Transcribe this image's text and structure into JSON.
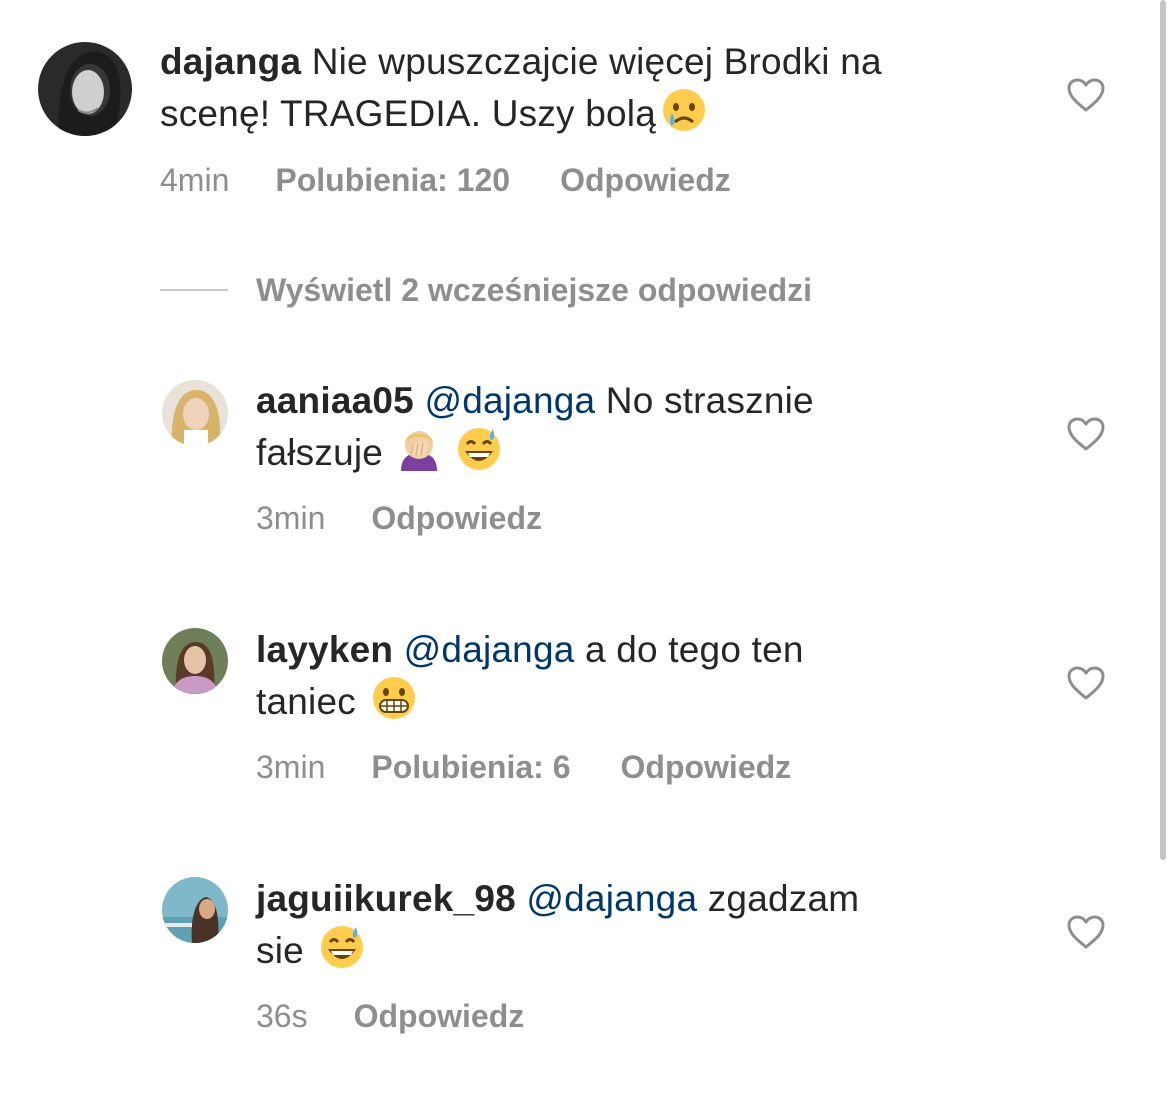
{
  "comments": [
    {
      "username": "dajanga",
      "text_line1": "Nie wpuszczajcie więcej Brodki na",
      "text_line2": "scenę! TRAGEDIA. Uszy bolą",
      "emoji": "crying-face",
      "time": "4min",
      "likes": "Polubienia: 120",
      "reply": "Odpowiedz"
    },
    {
      "username": "aaniaa05",
      "mention": "@dajanga",
      "text_line1": "No strasznie",
      "text_line2": "fałszuje",
      "emojis": [
        "face-palm",
        "grinning-sweat"
      ],
      "time": "3min",
      "reply": "Odpowiedz"
    },
    {
      "username": "layyken",
      "mention": "@dajanga",
      "text_line1": "a do tego ten",
      "text_line2": "taniec",
      "emoji": "grimacing-face",
      "time": "3min",
      "likes": "Polubienia: 6",
      "reply": "Odpowiedz"
    },
    {
      "username": "jaguiikurek_98",
      "mention": "@dajanga",
      "text_line1": "zgadzam",
      "text_line2": "sie",
      "emoji": "grinning-sweat",
      "time": "36s",
      "reply": "Odpowiedz"
    }
  ],
  "view_replies_label": "Wyświetl 2 wcześniejsze odpowiedzi",
  "colors": {
    "text": "#262626",
    "meta": "#8e8e8e",
    "mention": "#00376b",
    "divider": "#c7c7c7"
  }
}
